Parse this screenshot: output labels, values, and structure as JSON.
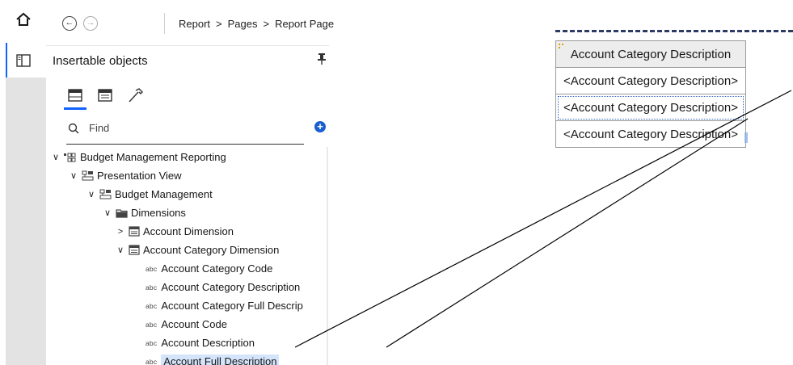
{
  "breadcrumb": {
    "items": [
      "Report",
      "Pages",
      "Report Page"
    ]
  },
  "panel": {
    "title": "Insertable objects"
  },
  "search": {
    "placeholder": "Find"
  },
  "tree": {
    "root": "Budget Management Reporting",
    "view": "Presentation View",
    "package": "Budget Management",
    "folder": "Dimensions",
    "dim1": "Account Dimension",
    "dim2": "Account Category Dimension",
    "items": [
      "Account Category Code",
      "Account Category Description",
      "Account Category Full Descrip",
      "Account Code",
      "Account Description",
      "Account Full Description"
    ],
    "abc": "abc"
  },
  "report_table": {
    "header": "Account Category Description",
    "rows": [
      "<Account Category Description>",
      "<Account Category Description>",
      "<Account Category Description>"
    ]
  },
  "colors": {
    "accent": "#0f62fe",
    "highlight": "#d4e4fb",
    "selection_border": "#3d6bbf"
  }
}
